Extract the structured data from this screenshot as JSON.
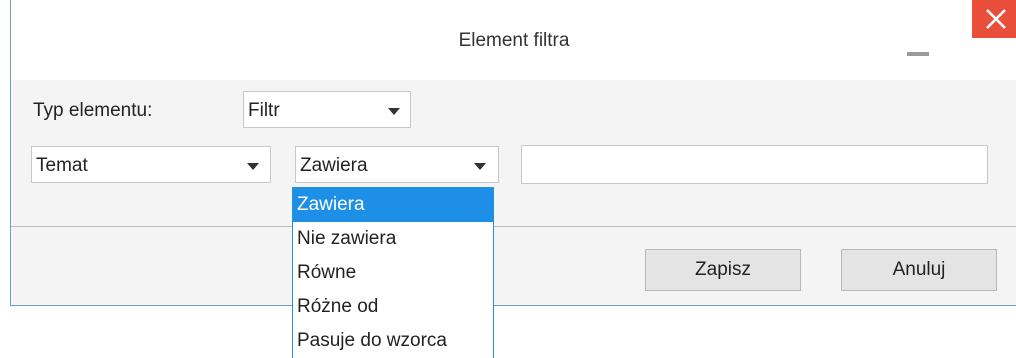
{
  "dialog": {
    "title": "Element filtra"
  },
  "type_row": {
    "label": "Typ elementu:",
    "value": "Filtr"
  },
  "condition_row": {
    "field_value": "Temat",
    "operator_value": "Zawiera",
    "text_value": ""
  },
  "operator_options": [
    "Zawiera",
    "Nie zawiera",
    "Równe",
    "Różne od",
    "Pasuje do wzorca"
  ],
  "buttons": {
    "save": "Zapisz",
    "cancel": "Anuluj"
  },
  "colors": {
    "close_bg": "#e94e3a",
    "selected_option_bg": "#1e8fe6",
    "dropdown_border": "#2a8fdb"
  }
}
